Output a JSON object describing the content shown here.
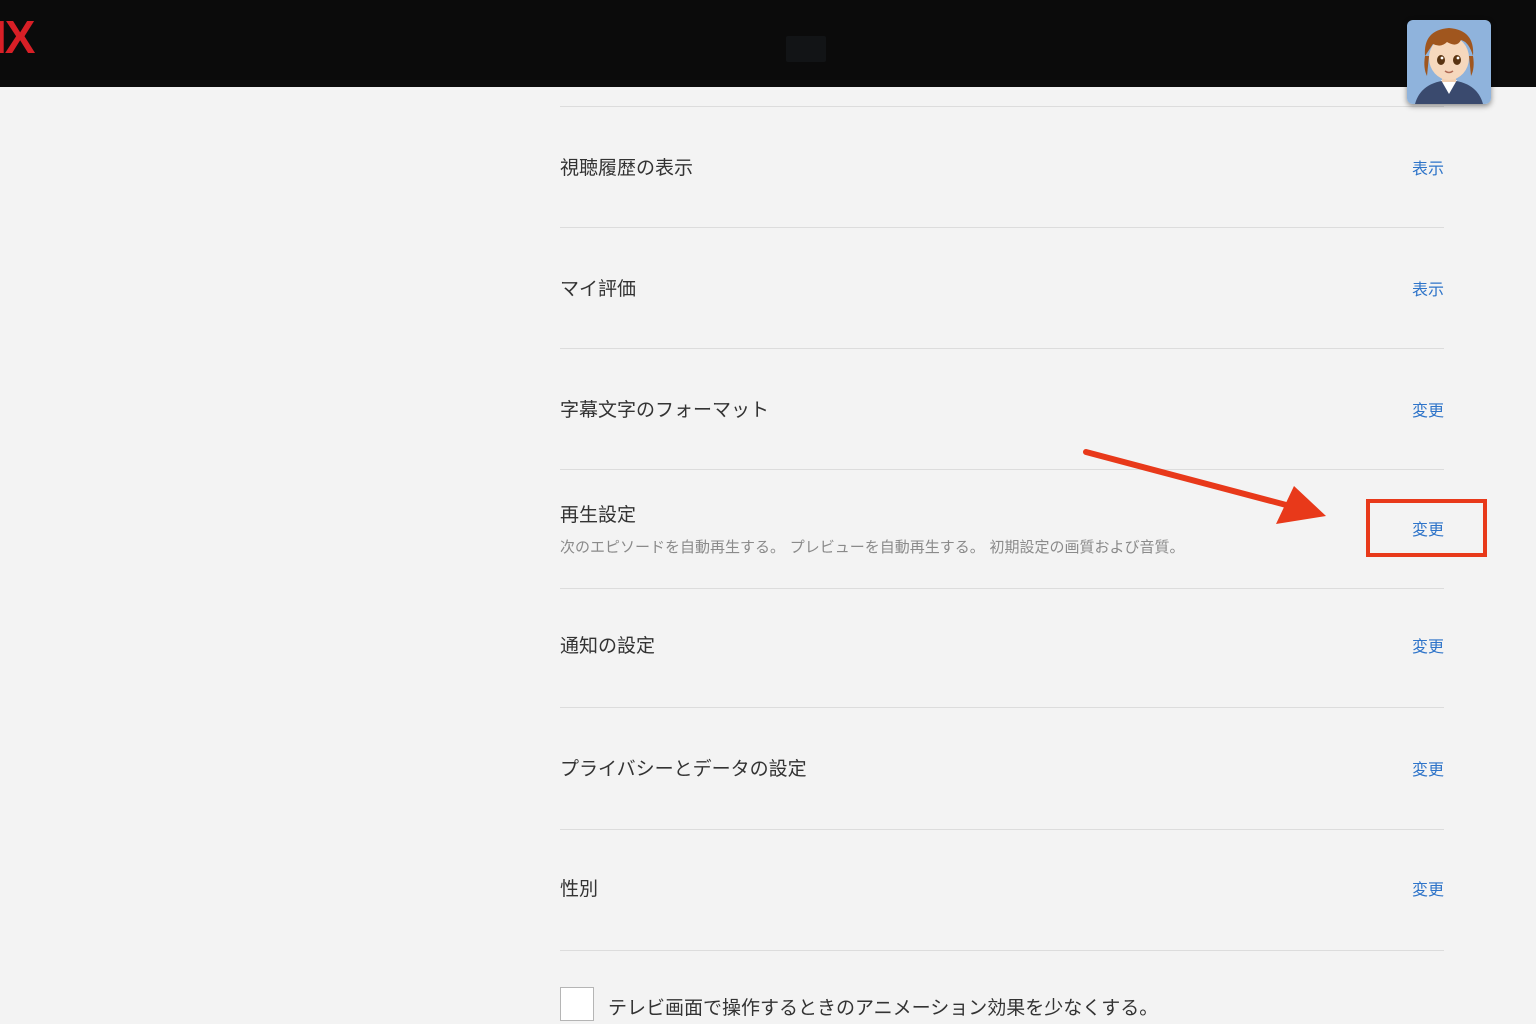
{
  "header": {
    "logo_text": "IX",
    "brand_color": "#d81f26",
    "avatar_icon": "profile-avatar-anime-boy"
  },
  "settings": {
    "rows": [
      {
        "title": "視聴履歴の表示",
        "link": "表示"
      },
      {
        "title": "マイ評価",
        "link": "表示"
      },
      {
        "title": "字幕文字のフォーマット",
        "link": "変更"
      },
      {
        "title": "再生設定",
        "description": "次のエピソードを自動再生する。 プレビューを自動再生する。 初期設定の画質および音質。",
        "link": "変更"
      },
      {
        "title": "通知の設定",
        "link": "変更"
      },
      {
        "title": "プライバシーとデータの設定",
        "link": "変更"
      },
      {
        "title": "性別",
        "link": "変更"
      }
    ],
    "link_color": "#2e74c9"
  },
  "reduce_animation": {
    "label": "テレビ画面で操作するときのアニメーション効果を少なくする。",
    "checked": false
  },
  "annotation": {
    "highlight_color": "#e8391a"
  }
}
